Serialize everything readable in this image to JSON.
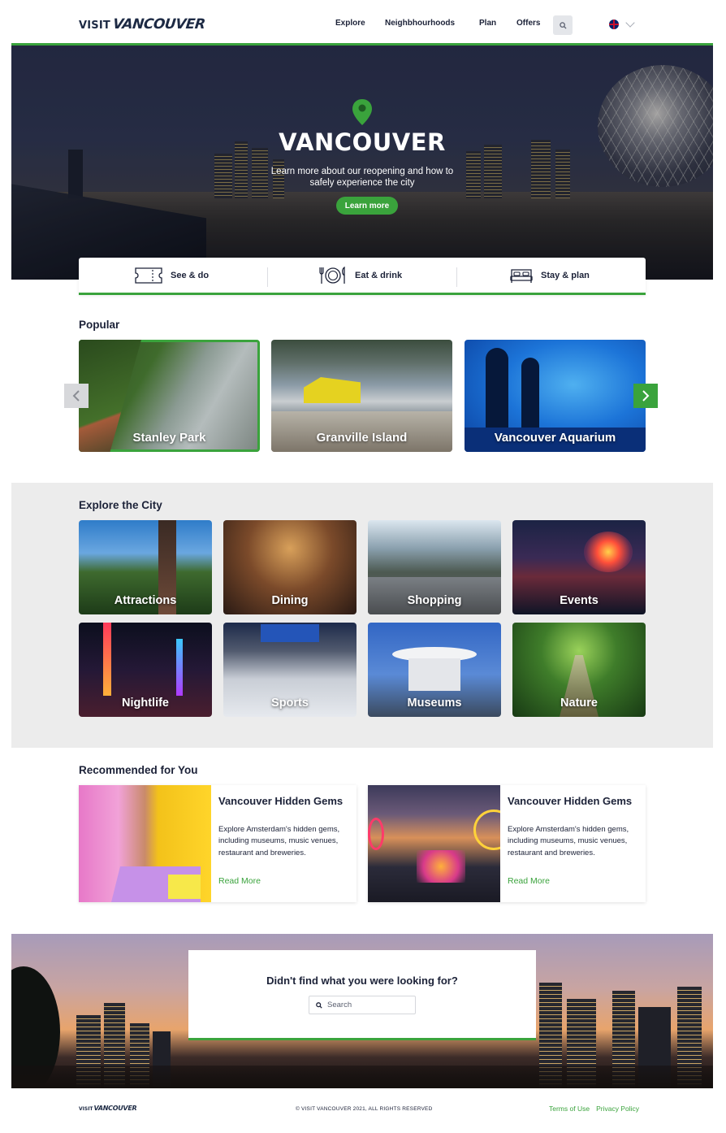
{
  "header": {
    "logo_visit": "VISIT",
    "logo_city": "VANCOUVER",
    "nav": [
      "Explore",
      "Neighbhourhoods",
      "Plan",
      "Offers"
    ],
    "search_icon": "search-icon",
    "language_flag": "uk-flag-icon"
  },
  "hero": {
    "title": "VANCOUVER",
    "subtitle": "Learn more about our reopening and how to safely experience the city",
    "button": "Learn more",
    "pin_color": "#3aa33c"
  },
  "categories": [
    {
      "label": "See & do",
      "icon": "ticket-icon"
    },
    {
      "label": "Eat & drink",
      "icon": "plate-cutlery-icon"
    },
    {
      "label": "Stay & plan",
      "icon": "bed-icon"
    }
  ],
  "popular": {
    "title": "Popular",
    "items": [
      "Stanley Park",
      "Granville Island",
      "Vancouver Aquarium"
    ]
  },
  "explore": {
    "title": "Explore the City",
    "items": [
      "Attractions",
      "Dining",
      "Shopping",
      "Events",
      "Nightlife",
      "Sports",
      "Museums",
      "Nature"
    ]
  },
  "recommended": {
    "title": "Recommended for You",
    "cards": [
      {
        "title": "Vancouver Hidden Gems",
        "desc": "Explore Amsterdam's hidden gems, including museums, music venues, restaurant and breweries.",
        "link": "Read More"
      },
      {
        "title": "Vancouver Hidden Gems",
        "desc": "Explore Amsterdam's hidden gems, including museums, music venues, restaurant and breweries.",
        "link": "Read More"
      }
    ]
  },
  "search_banner": {
    "question": "Didn't find what you were looking for?",
    "placeholder": "Search"
  },
  "footer": {
    "logo_visit": "VISIT",
    "logo_city": "VANCOUVER",
    "copyright": "© VISIT VANCOUVER 2021, ALL RIGHTS RESERVED",
    "links": [
      "Terms of Use",
      "Privacy Policy"
    ]
  },
  "colors": {
    "accent": "#3aa33c",
    "text": "#1c2238",
    "section_bg": "#ececec"
  }
}
